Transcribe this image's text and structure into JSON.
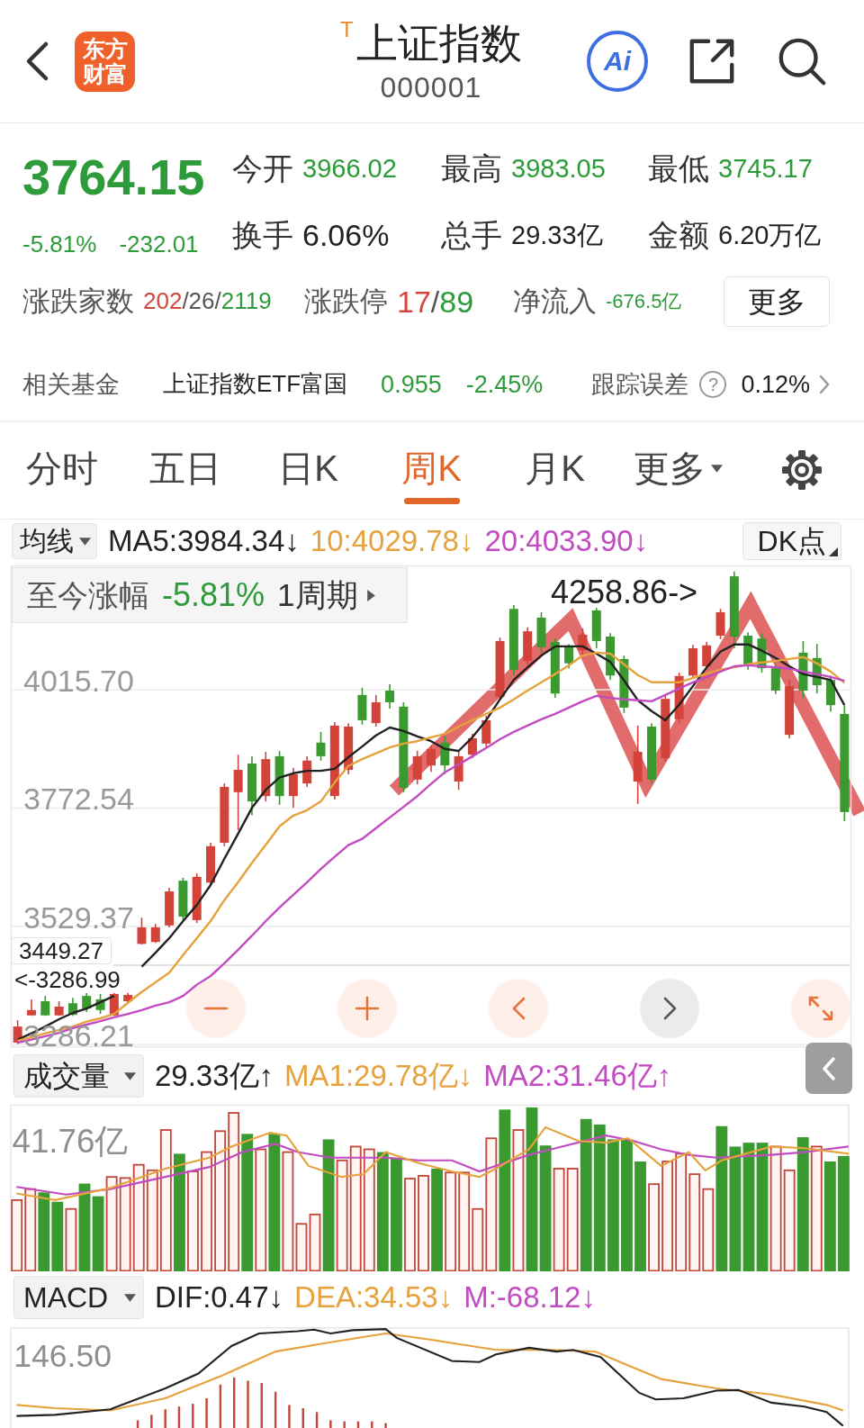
{
  "header": {
    "logo_text": "东方财富",
    "trade_mark": "T",
    "title": "上证指数",
    "code": "000001",
    "ai_label": "Ai"
  },
  "quote": {
    "price": "3764.15",
    "change_pct": "-5.81%",
    "change": "-232.01",
    "falling": true,
    "stats": [
      {
        "label": "今开",
        "value": "3966.02",
        "color": "#2e9b3a"
      },
      {
        "label": "最高",
        "value": "3983.05",
        "color": "#2e9b3a"
      },
      {
        "label": "最低",
        "value": "3745.17",
        "color": "#2e9b3a"
      },
      {
        "label": "换手",
        "value": "6.06%",
        "color": "#222222"
      },
      {
        "label": "总手",
        "value": "29.33亿",
        "color": "#222222"
      },
      {
        "label": "金额",
        "value": "6.20万亿",
        "color": "#222222"
      }
    ],
    "breadth": [
      {
        "label": "涨跌家数",
        "parts": [
          {
            "text": "202",
            "color": "#d6453b"
          },
          {
            "text": "/26/",
            "color": "#555555"
          },
          {
            "text": "2119",
            "color": "#2e9b3a"
          }
        ]
      },
      {
        "label": "涨跌停",
        "parts": [
          {
            "text": "17",
            "color": "#d6453b"
          },
          {
            "text": "/",
            "color": "#555555"
          },
          {
            "text": "89",
            "color": "#2e9b3a"
          }
        ]
      },
      {
        "label": "净流入",
        "parts": [
          {
            "text": "-676.5亿",
            "color": "#2e9b3a"
          }
        ]
      }
    ],
    "more_button": "更多"
  },
  "fund": {
    "label": "相关基金",
    "name": "上证指数ETF富国",
    "price": "0.955",
    "change": "-2.45%",
    "falling": true,
    "tracking_label": "跟踪误差",
    "help_mark": "?",
    "tracking_value": "0.12%"
  },
  "tabs": [
    {
      "label": "分时",
      "kind": "tab",
      "selected": false
    },
    {
      "label": "五日",
      "kind": "tab",
      "selected": false
    },
    {
      "label": "日K",
      "kind": "tab",
      "selected": false
    },
    {
      "label": "周K",
      "kind": "tab",
      "selected": true
    },
    {
      "label": "月K",
      "kind": "tab",
      "selected": false
    },
    {
      "label": "更多",
      "kind": "menu",
      "selected": false
    }
  ],
  "ma_legend": {
    "selector": "均线",
    "items": [
      {
        "text": "MA5:3984.34↓",
        "color": "#222222"
      },
      {
        "text": "10:4029.78↓",
        "color": "#e6a23c"
      },
      {
        "text": "20:4033.90↓",
        "color": "#c24bc2"
      }
    ],
    "mode_button": "DK点"
  },
  "price_chart": {
    "range_panel": {
      "label": "至今涨幅",
      "value": "-5.81%",
      "falling": true,
      "period": "1周期"
    },
    "high_marker": "4258.86->",
    "low_marker": "<-3286.99",
    "price_label": "3449.27",
    "zoom_controls": [
      {
        "kind": "zoom_out",
        "disabled": false
      },
      {
        "kind": "zoom_in",
        "disabled": false
      },
      {
        "kind": "scroll_left",
        "disabled": false
      },
      {
        "kind": "scroll_right",
        "disabled": true
      },
      {
        "kind": "fullscreen",
        "disabled": false
      }
    ],
    "chart_data": {
      "type": "candlestick",
      "grid": true,
      "ylim": [
        3286.21,
        4267.7
      ],
      "yticks": [
        {
          "value": 4015.7,
          "label": "4015.70"
        },
        {
          "value": 3772.54,
          "label": "3772.54"
        },
        {
          "value": 3529.37,
          "label": "3529.37"
        },
        {
          "value": 3286.21,
          "label": "3286.21"
        }
      ],
      "ohlc": [
        [
          3290,
          3336,
          3286.99,
          3323
        ],
        [
          3346,
          3379,
          3345,
          3357
        ],
        [
          3375,
          3386,
          3345,
          3346
        ],
        [
          3346,
          3375,
          3345,
          3364
        ],
        [
          3371,
          3382,
          3345,
          3347
        ],
        [
          3386,
          3392,
          3353,
          3360
        ],
        [
          3379,
          3390,
          3349,
          3357
        ],
        [
          3346,
          3392,
          3345,
          3390
        ],
        [
          3375,
          3392,
          3370,
          3388
        ],
        [
          3493,
          3547,
          3492,
          3527
        ],
        [
          3497,
          3534,
          3495,
          3527
        ],
        [
          3531,
          3608,
          3527,
          3601
        ],
        [
          3623,
          3629,
          3542,
          3549
        ],
        [
          3542,
          3638,
          3536,
          3631
        ],
        [
          3619,
          3701,
          3614,
          3694
        ],
        [
          3701,
          3823,
          3694,
          3816
        ],
        [
          3805,
          3882,
          3727,
          3851
        ],
        [
          3864,
          3879,
          3758,
          3786
        ],
        [
          3797,
          3888,
          3786,
          3873
        ],
        [
          3879,
          3890,
          3779,
          3797
        ],
        [
          3797,
          3855,
          3773,
          3842
        ],
        [
          3823,
          3879,
          3816,
          3870
        ],
        [
          3907,
          3929,
          3870,
          3879
        ],
        [
          3797,
          3949,
          3790,
          3942
        ],
        [
          3851,
          3947,
          3842,
          3940
        ],
        [
          4005,
          4020,
          3944,
          3953
        ],
        [
          3947,
          4005,
          3940,
          3990
        ],
        [
          4014,
          4027,
          3977,
          3990
        ],
        [
          3981,
          3990,
          3805,
          3814
        ],
        [
          3831,
          3890,
          3821,
          3879
        ],
        [
          3860,
          3901,
          3847,
          3894
        ],
        [
          3907,
          3920,
          3842,
          3860
        ],
        [
          3827,
          3890,
          3810,
          3879
        ],
        [
          3882,
          3925,
          3875,
          3916
        ],
        [
          3905,
          3962,
          3897,
          3953
        ],
        [
          4001,
          4123,
          3994,
          4116
        ],
        [
          4182,
          4190,
          4045,
          4057
        ],
        [
          4075,
          4144,
          4068,
          4136
        ],
        [
          4164,
          4175,
          4092,
          4103
        ],
        [
          4114,
          4121,
          3999,
          4008
        ],
        [
          4103,
          4110,
          4060,
          4070
        ],
        [
          4097,
          4142,
          4086,
          4129
        ],
        [
          4179,
          4184,
          4101,
          4116
        ],
        [
          4125,
          4132,
          4036,
          4045
        ],
        [
          4079,
          4086,
          3968,
          3979
        ],
        [
          3827,
          3942,
          3781,
          3888
        ],
        [
          3940,
          3947,
          3823,
          3831
        ],
        [
          3875,
          4005,
          3868,
          3997
        ],
        [
          3955,
          4051,
          3947,
          4044
        ],
        [
          4045,
          4108,
          4038,
          4101
        ],
        [
          4064,
          4114,
          4057,
          4107
        ],
        [
          4127,
          4182,
          4120,
          4175
        ],
        [
          4249,
          4258.86,
          4101,
          4125
        ],
        [
          4127,
          4134,
          4057,
          4064
        ],
        [
          4121,
          4131,
          4051,
          4060
        ],
        [
          4060,
          4068,
          4007,
          4014
        ],
        [
          3923,
          4036,
          3916,
          4023
        ],
        [
          4092,
          4116,
          3999,
          4014
        ],
        [
          4081,
          4110,
          4008,
          4025
        ],
        [
          4036,
          4045,
          3971,
          3984
        ],
        [
          3966.02,
          3983.05,
          3745.17,
          3764.15
        ]
      ],
      "series": [
        {
          "type": "line",
          "color": "#222222",
          "values": [
            3296,
            3309,
            3323,
            3338,
            3351,
            3360,
            3373,
            3386,
            null,
            3446,
            3475,
            3505,
            3540,
            3573,
            3614,
            3668,
            3720,
            3773,
            3810,
            3835,
            3844,
            3849,
            3849,
            3853,
            3877,
            3899,
            3922,
            3938,
            3931,
            3920,
            3910,
            3894,
            3890,
            3918,
            3953,
            3996,
            4036,
            4062,
            4086,
            4105,
            4105,
            4105,
            4090,
            4073,
            4035,
            3994,
            3972,
            3953,
            3985,
            4023,
            4062,
            4094,
            4109,
            4109,
            4096,
            4081,
            4064,
            4048,
            4042,
            4036,
            3984
          ]
        },
        {
          "type": "line",
          "color": "#e6a23c",
          "values": [
            3294,
            3301,
            3309,
            3316,
            3323,
            3333,
            3340,
            3349,
            3372,
            3394,
            3414,
            3434,
            3470,
            3505,
            3540,
            3583,
            3620,
            3660,
            3697,
            3735,
            3757,
            3768,
            3786,
            3825,
            3859,
            3873,
            3885,
            3897,
            3905,
            3910,
            3918,
            3925,
            3940,
            3953,
            3966,
            3979,
            3996,
            4014,
            4031,
            4048,
            4066,
            4086,
            4092,
            4090,
            4068,
            4046,
            4031,
            4031,
            4031,
            4040,
            4049,
            4057,
            4062,
            4068,
            4072,
            4075,
            4079,
            4083,
            4070,
            4053,
            4030
          ]
        },
        {
          "type": "line",
          "color": "#c24bc2",
          "values": [
            3290,
            3296,
            3303,
            3310,
            3320,
            3327,
            3334,
            3342,
            3349,
            3357,
            3366,
            3373,
            3386,
            3409,
            3427,
            3453,
            3481,
            3510,
            3540,
            3568,
            3594,
            3620,
            3647,
            3672,
            3696,
            3709,
            3731,
            3753,
            3775,
            3797,
            3822,
            3846,
            3862,
            3879,
            3896,
            3914,
            3929,
            3942,
            3955,
            3966,
            3979,
            3992,
            4003,
            3999,
            3996,
            3994,
            3992,
            4005,
            4018,
            4031,
            4042,
            4053,
            4064,
            4066,
            4064,
            4062,
            4059,
            4053,
            4048,
            4042,
            4034
          ]
        }
      ]
    }
  },
  "volume": {
    "selector": "成交量",
    "items": [
      {
        "text": "29.33亿↑",
        "color": "#222222"
      },
      {
        "text": "MA1:29.78亿↓",
        "color": "#e6a23c"
      },
      {
        "text": "MA2:31.46亿↑",
        "color": "#c24bc2"
      }
    ],
    "axis_label": "41.76亿"
  },
  "macd": {
    "selector": "MACD",
    "items": [
      {
        "text": "DIF:0.47↓",
        "color": "#222222"
      },
      {
        "text": "DEA:34.53↓",
        "color": "#e6a23c"
      },
      {
        "text": "M:-68.12↓",
        "color": "#c24bc2"
      }
    ],
    "axis_label": "146.50"
  }
}
